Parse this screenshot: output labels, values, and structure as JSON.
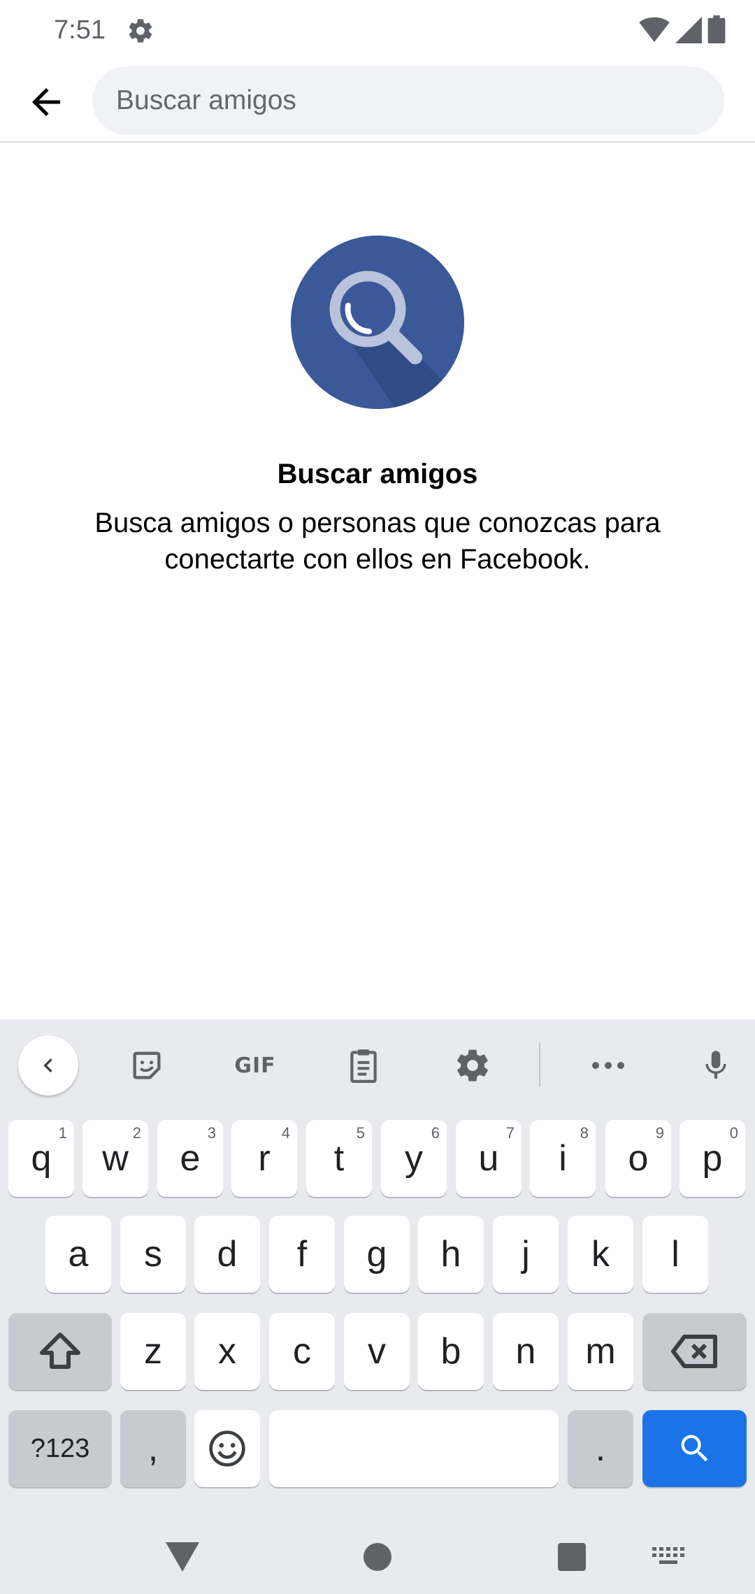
{
  "status_bar": {
    "time": "7:51",
    "icons": [
      "settings-icon",
      "wifi-icon",
      "cell-signal-icon",
      "battery-icon"
    ]
  },
  "header": {
    "back_icon": "arrow-left-icon",
    "search_placeholder": "Buscar amigos",
    "search_value": ""
  },
  "empty_state": {
    "icon": "magnifier-circle-icon",
    "title": "Buscar amigos",
    "description": "Busca amigos o personas que conozcas para conectarte con ellos en Facebook."
  },
  "keyboard": {
    "toolbar": {
      "gif_label": "GIF",
      "icons": [
        "chevron-left-icon",
        "sticker-icon",
        "gif-icon",
        "clipboard-icon",
        "gear-icon",
        "more-icon",
        "mic-icon"
      ]
    },
    "row1": [
      {
        "key": "q",
        "hint": "1"
      },
      {
        "key": "w",
        "hint": "2"
      },
      {
        "key": "e",
        "hint": "3"
      },
      {
        "key": "r",
        "hint": "4"
      },
      {
        "key": "t",
        "hint": "5"
      },
      {
        "key": "y",
        "hint": "6"
      },
      {
        "key": "u",
        "hint": "7"
      },
      {
        "key": "i",
        "hint": "8"
      },
      {
        "key": "o",
        "hint": "9"
      },
      {
        "key": "p",
        "hint": "0"
      }
    ],
    "row2": [
      "a",
      "s",
      "d",
      "f",
      "g",
      "h",
      "j",
      "k",
      "l"
    ],
    "row3": [
      "z",
      "x",
      "c",
      "v",
      "b",
      "n",
      "m"
    ],
    "row4": {
      "symbols_label": "?123",
      "comma_label": ",",
      "period_label": "."
    }
  },
  "colors": {
    "accent": "#1a73e8",
    "facebook_blue": "#3b5998",
    "search_bg": "#f0f2f5",
    "keyboard_bg": "#e8eaed"
  }
}
